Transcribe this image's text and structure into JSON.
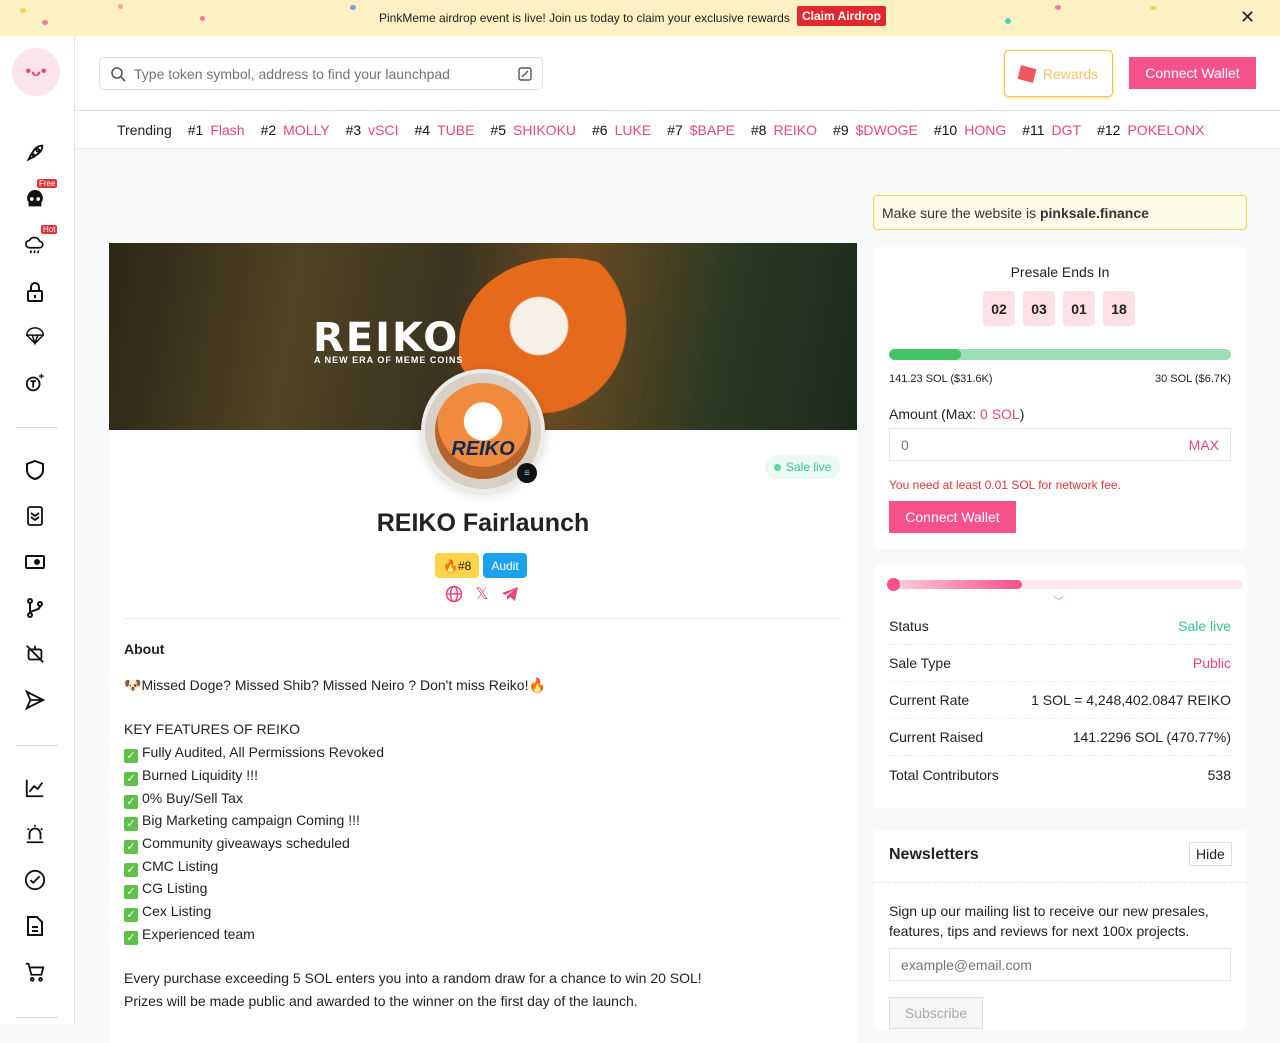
{
  "banner": {
    "message": "PinkMeme airdrop event is live! Join us today to claim your exclusive rewards",
    "claim": "Claim Airdrop"
  },
  "header": {
    "search_placeholder": "Type token symbol, address to find your launchpad",
    "rewards": "Rewards",
    "connect": "Connect Wallet"
  },
  "sidebar": {
    "badges": {
      "free": "Free",
      "hot": "Hot"
    }
  },
  "trending": {
    "label": "Trending",
    "items": [
      {
        "rank": "#1",
        "name": "Flash"
      },
      {
        "rank": "#2",
        "name": "MOLLY"
      },
      {
        "rank": "#3",
        "name": "vSCI"
      },
      {
        "rank": "#4",
        "name": "TUBE"
      },
      {
        "rank": "#5",
        "name": "SHIKOKU"
      },
      {
        "rank": "#6",
        "name": "LUKE"
      },
      {
        "rank": "#7",
        "name": "$BAPE"
      },
      {
        "rank": "#8",
        "name": "REIKO"
      },
      {
        "rank": "#9",
        "name": "$DWOGE"
      },
      {
        "rank": "#10",
        "name": "HONG"
      },
      {
        "rank": "#11",
        "name": "DGT"
      },
      {
        "rank": "#12",
        "name": "POKELONX"
      }
    ]
  },
  "project": {
    "hero_brand": "REIKO",
    "hero_tagline": "A NEW ERA OF MEME COINS",
    "avatar_text": "REIKO",
    "status": "Sale live",
    "title": "REIKO Fairlaunch",
    "rank_badge": "#8",
    "audit_badge": "Audit",
    "about_heading": "About",
    "intro": "Missed Doge? Missed Shib? Missed Neiro ? Don't miss Reiko!",
    "features_heading": "KEY FEATURES OF REIKO",
    "features": [
      "Fully Audited, All Permissions Revoked",
      "Burned Liquidity !!!",
      "0% Buy/Sell Tax",
      "Big Marketing campaign Coming !!!",
      "Community giveaways scheduled",
      "CMC Listing",
      "CG Listing",
      "Cex Listing",
      "Experienced team"
    ],
    "promo1": "Every purchase exceeding 5 SOL enters you into a random draw for a chance to win 20 SOL!",
    "promo2": "Prizes will be made public and awarded to the winner on the first day of the launch."
  },
  "notice": {
    "prefix": "Make sure the website is ",
    "domain": "pinksale.finance"
  },
  "presale": {
    "heading": "Presale Ends In",
    "countdown": [
      "02",
      "03",
      "01",
      "18"
    ],
    "progress_percent": 21,
    "raised": "141.23 SOL ($31.6K)",
    "target": "30 SOL ($6.7K)",
    "amount_label": "Amount (Max: ",
    "max_value": "0 SOL",
    "amount_close": ")",
    "amount_placeholder": "0",
    "max_button": "MAX",
    "fee_warning": "You need at least 0.01 SOL for network fee.",
    "connect": "Connect Wallet"
  },
  "info": {
    "stage_progress_percent": 38,
    "rows": [
      {
        "label": "Status",
        "value": "Sale live"
      },
      {
        "label": "Sale Type",
        "value": "Public"
      },
      {
        "label": "Current Rate",
        "value": "1 SOL = 4,248,402.0847 REIKO"
      },
      {
        "label": "Current Raised",
        "value": "141.2296 SOL (470.77%)"
      },
      {
        "label": "Total Contributors",
        "value": "538"
      }
    ]
  },
  "newsletter": {
    "heading": "Newsletters",
    "hide": "Hide",
    "text": "Sign up our mailing list to receive our new presales, features, tips and reviews for next 100x projects.",
    "placeholder": "example@email.com",
    "subscribe": "Subscribe"
  },
  "colors": {
    "pink": "#f5528c",
    "green": "#34c38f",
    "banner": "#fdf0c3"
  }
}
